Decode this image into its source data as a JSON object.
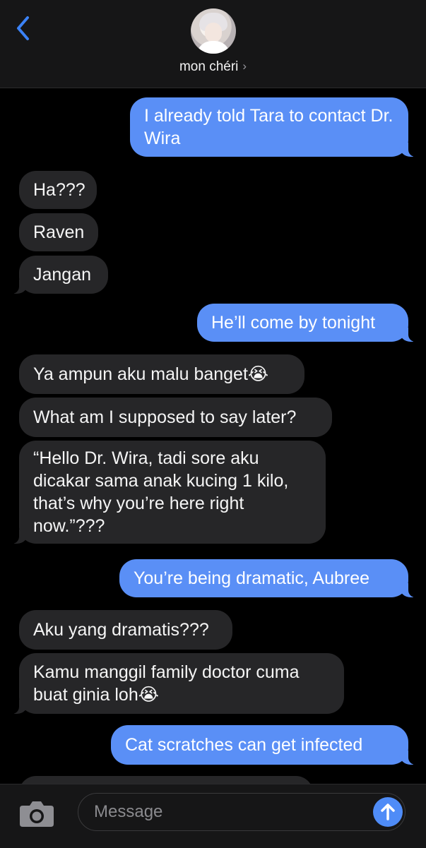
{
  "header": {
    "contact_name": "mon chéri",
    "chevron": "›",
    "icons": {
      "back": "chevron-left-icon",
      "avatar": "avatar"
    }
  },
  "messages": [
    {
      "from": "me",
      "text": "I already told Tara to contact Dr. Wira"
    },
    {
      "from": "them",
      "text": "Ha???"
    },
    {
      "from": "them",
      "text": "Raven"
    },
    {
      "from": "them",
      "text": "Jangan"
    },
    {
      "from": "me",
      "text": "He’ll come by tonight"
    },
    {
      "from": "them",
      "text": "Ya ampun aku malu banget😭"
    },
    {
      "from": "them",
      "text": "What am I supposed to say later?"
    },
    {
      "from": "them",
      "text": "“Hello Dr. Wira, tadi sore aku dicakar sama anak kucing 1 kilo, that’s why you’re here right now.”???"
    },
    {
      "from": "me",
      "text": "You’re being dramatic, Aubree"
    },
    {
      "from": "them",
      "text": "Aku yang dramatis???"
    },
    {
      "from": "them",
      "text": "Kamu manggil family doctor cuma buat ginia loh😭"
    },
    {
      "from": "me",
      "text": "Cat scratches can get infected"
    }
  ],
  "compose": {
    "placeholder": "Message",
    "icons": {
      "camera": "camera-icon",
      "send": "send-arrow-icon"
    }
  },
  "colors": {
    "outgoing_bubble": "#5a8ff6",
    "incoming_bubble": "#262628",
    "background": "#000000",
    "bar": "#161617",
    "accent": "#3b82f6"
  }
}
